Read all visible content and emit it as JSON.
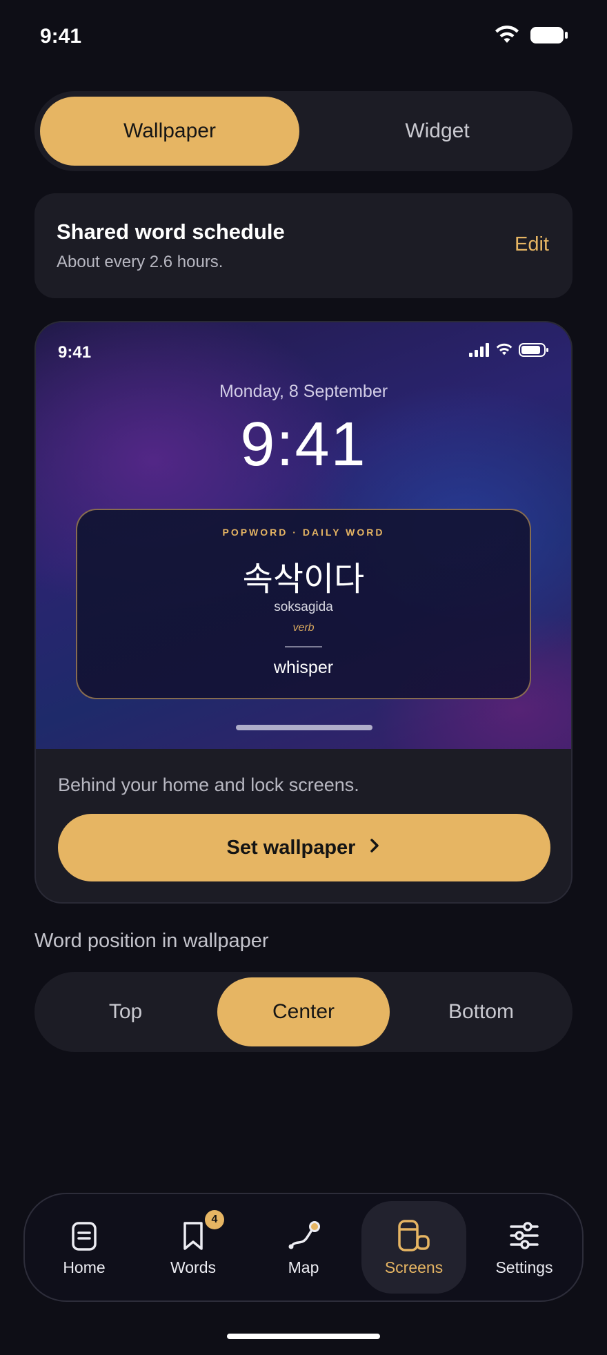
{
  "status_bar": {
    "time": "9:41"
  },
  "mode_toggle": {
    "wallpaper_label": "Wallpaper",
    "widget_label": "Widget",
    "selected": "Wallpaper"
  },
  "schedule": {
    "title": "Shared word schedule",
    "subtitle": "About every 2.6 hours.",
    "edit_label": "Edit"
  },
  "preview": {
    "status_time": "9:41",
    "date": "Monday, 8 September",
    "clock": "9:41",
    "word_card": {
      "brand": "POPWORD · DAILY WORD",
      "word": "속삭이다",
      "romanization": "soksagida",
      "part_of_speech": "verb",
      "meaning": "whisper"
    },
    "description": "Behind your home and lock screens.",
    "set_button_label": "Set wallpaper"
  },
  "word_position": {
    "label": "Word position in wallpaper",
    "options": [
      "Top",
      "Center",
      "Bottom"
    ],
    "selected": "Center"
  },
  "tab_bar": {
    "items": [
      {
        "label": "Home",
        "icon": "document-icon"
      },
      {
        "label": "Words",
        "icon": "bookmark-icon",
        "badge": "4"
      },
      {
        "label": "Map",
        "icon": "path-icon"
      },
      {
        "label": "Screens",
        "icon": "devices-icon"
      },
      {
        "label": "Settings",
        "icon": "sliders-icon"
      }
    ],
    "active": "Screens"
  },
  "colors": {
    "accent": "#e6b563",
    "background": "#0e0e16",
    "surface": "#1c1c25"
  }
}
